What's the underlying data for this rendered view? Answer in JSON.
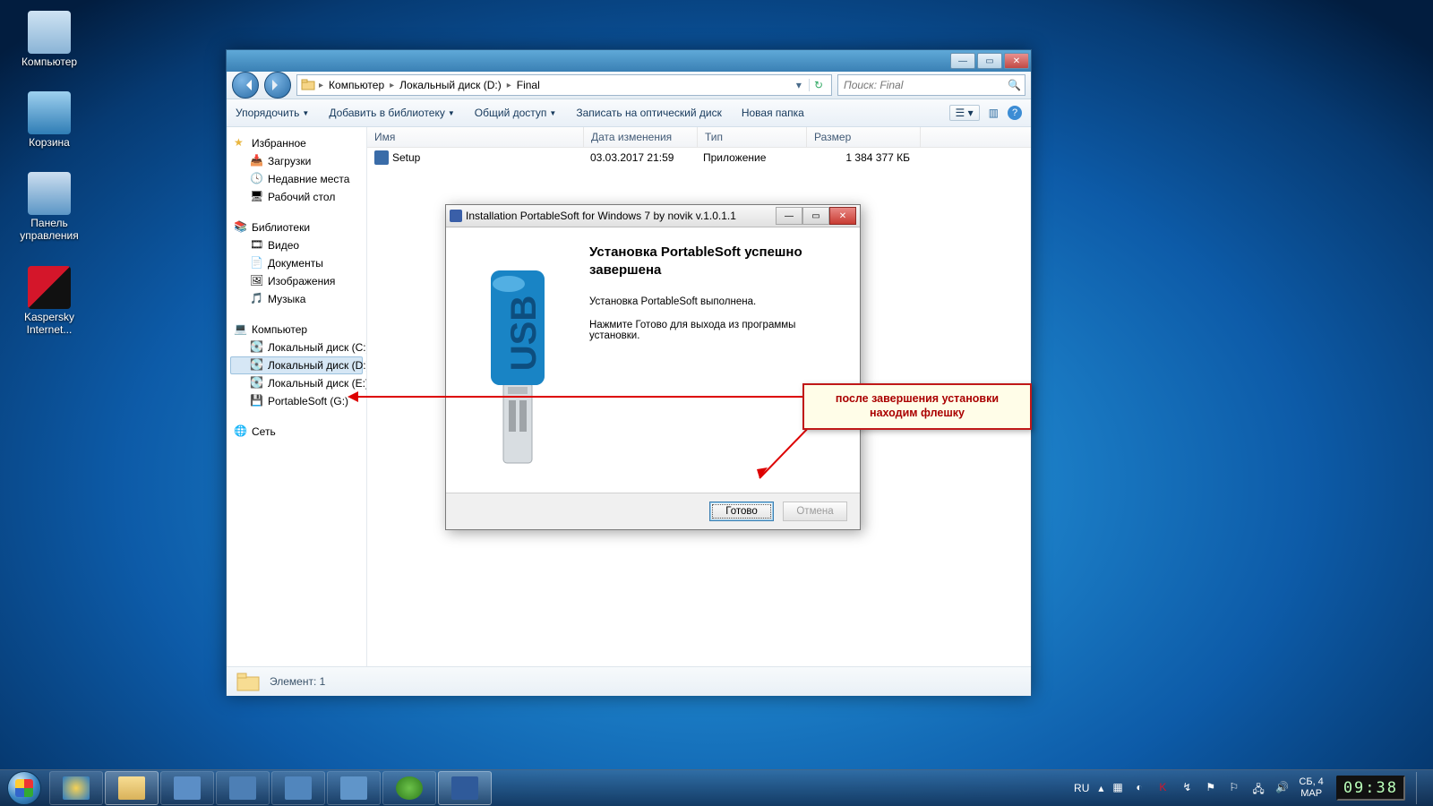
{
  "desktop": {
    "icons": [
      {
        "label": "Компьютер"
      },
      {
        "label": "Корзина"
      },
      {
        "label": "Панель управления"
      },
      {
        "label": "Kaspersky Internet..."
      }
    ]
  },
  "explorer": {
    "window_controls": {
      "min": "—",
      "max": "▭",
      "close": "✕"
    },
    "breadcrumb": [
      "Компьютер",
      "Локальный диск (D:)",
      "Final"
    ],
    "search_placeholder": "Поиск: Final",
    "toolbar": {
      "organize": "Упорядочить",
      "library": "Добавить в библиотеку",
      "share": "Общий доступ",
      "burn": "Записать на оптический диск",
      "newfolder": "Новая папка"
    },
    "nav": {
      "favorites": "Избранное",
      "fav_items": [
        "Загрузки",
        "Недавние места",
        "Рабочий стол"
      ],
      "libraries": "Библиотеки",
      "lib_items": [
        "Видео",
        "Документы",
        "Изображения",
        "Музыка"
      ],
      "computer": "Компьютер",
      "drives": [
        "Локальный диск (C:)",
        "Локальный диск (D:)",
        "Локальный диск (E:)",
        "PortableSoft (G:)"
      ],
      "network": "Сеть"
    },
    "columns": {
      "name": "Имя",
      "date": "Дата изменения",
      "type": "Тип",
      "size": "Размер"
    },
    "row": {
      "name": "Setup",
      "date": "03.03.2017 21:59",
      "type": "Приложение",
      "size": "1 384 377 КБ"
    },
    "status": "Элемент: 1"
  },
  "dialog": {
    "title": "Installation PortableSoft for Windows 7 by novik v.1.0.1.1",
    "heading": "Установка PortableSoft успешно завершена",
    "line1": "Установка PortableSoft выполнена.",
    "line2": "Нажмите Готово для выхода из программы установки.",
    "finish": "Готово",
    "cancel": "Отмена"
  },
  "callout": {
    "line1": "после завершения установки",
    "line2": "находим флешку"
  },
  "taskbar": {
    "lang": "RU",
    "day": "СБ, 4",
    "month": "МАР",
    "clock": "09:38"
  }
}
